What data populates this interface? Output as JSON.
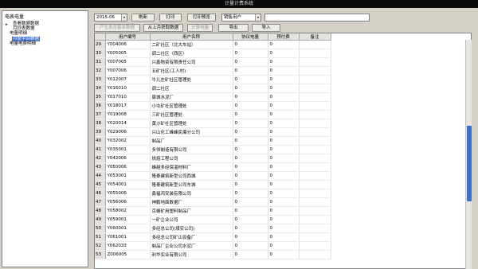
{
  "window": {
    "title": "计量计费系统"
  },
  "tree": {
    "root": "电表电量",
    "items": [
      {
        "label": "查看数据数据",
        "selected": false
      },
      {
        "label": "月抄表数据",
        "selected": false
      },
      {
        "label": "电量明细",
        "selected": false
      },
      {
        "label": "月度中间数据",
        "selected": true
      },
      {
        "label": "电量电费明细",
        "selected": false
      }
    ]
  },
  "toolbar": {
    "month_value": "2015-06",
    "refresh_label": "刷新",
    "print_label": "打印",
    "print_preview_label": "打印预览",
    "user_type_value": "销售用户",
    "search_value": "",
    "generate_label": "产生本月基本数据",
    "fetch_last_label": "从上月获取数据",
    "calc_power_label": "计算电量",
    "export_label": "导出",
    "import_label": "导入"
  },
  "table": {
    "columns": [
      "",
      "用户编号",
      "用户名称",
      "协议电量",
      "预付费",
      "备注"
    ],
    "rows": [
      {
        "n": "29",
        "id": "Y004006",
        "name": "二矿社区（北大车站）",
        "qty": "0",
        "prepay": "0",
        "note": ""
      },
      {
        "n": "30",
        "id": "Y005005",
        "name": "调二社区（西区）",
        "qty": "0",
        "prepay": "0",
        "note": ""
      },
      {
        "n": "31",
        "id": "Y007005",
        "name": "兴鑫物资有限责任公司",
        "qty": "0",
        "prepay": "0",
        "note": ""
      },
      {
        "n": "32",
        "id": "Y007006",
        "name": "五矿社区(工人村)",
        "qty": "0",
        "prepay": "0",
        "note": ""
      },
      {
        "n": "33",
        "id": "Y012007",
        "name": "牛儿庄矿社区管理处",
        "qty": "0",
        "prepay": "0",
        "note": ""
      },
      {
        "n": "34",
        "id": "Y016010",
        "name": "调二社区",
        "qty": "0",
        "prepay": "0",
        "note": ""
      },
      {
        "n": "35",
        "id": "Y017010",
        "name": "康城水泥厂",
        "qty": "0",
        "prepay": "0",
        "note": ""
      },
      {
        "n": "36",
        "id": "Y018017",
        "name": "小屯矿社区管理处",
        "qty": "0",
        "prepay": "0",
        "note": ""
      },
      {
        "n": "37",
        "id": "Y019008",
        "name": "三矿社区管理处",
        "qty": "0",
        "prepay": "0",
        "note": ""
      },
      {
        "n": "38",
        "id": "Y020014",
        "name": "黄沙矿社区管理处",
        "qty": "0",
        "prepay": "0",
        "note": ""
      },
      {
        "n": "39",
        "id": "Y029006",
        "name": "兴山化工峰峰民爆分公司",
        "qty": "0",
        "prepay": "0",
        "note": ""
      },
      {
        "n": "40",
        "id": "Y032002",
        "name": "制品厂",
        "qty": "0",
        "prepay": "0",
        "note": ""
      },
      {
        "n": "41",
        "id": "Y035001",
        "name": "多领制造有限公司",
        "qty": "0",
        "prepay": "0",
        "note": ""
      },
      {
        "n": "42",
        "id": "Y042006",
        "name": "烘焙工程公司",
        "qty": "0",
        "prepay": "0",
        "note": ""
      },
      {
        "n": "43",
        "id": "Y050006",
        "name": "峰越多经保温材料厂",
        "qty": "0",
        "prepay": "0",
        "note": ""
      },
      {
        "n": "44",
        "id": "Y053001",
        "name": "隆泰建筑新型公司西城",
        "qty": "0",
        "prepay": "0",
        "note": ""
      },
      {
        "n": "45",
        "id": "Y054001",
        "name": "隆泰建筑新型公司东城",
        "qty": "0",
        "prepay": "0",
        "note": ""
      },
      {
        "n": "46",
        "id": "Y055006",
        "name": "鑫福鸿安装有限公司",
        "qty": "0",
        "prepay": "0",
        "note": ""
      },
      {
        "n": "47",
        "id": "Y056006",
        "name": "神鹏地面数据厂",
        "qty": "0",
        "prepay": "0",
        "note": ""
      },
      {
        "n": "48",
        "id": "Y058002",
        "name": "京峰矿用塑料制品厂",
        "qty": "0",
        "prepay": "0",
        "note": ""
      },
      {
        "n": "49",
        "id": "Y059001",
        "name": "一矿企业公司",
        "qty": "0",
        "prepay": "0",
        "note": ""
      },
      {
        "n": "50",
        "id": "Y060001",
        "name": "多经总公司(煤安公司)",
        "qty": "0",
        "prepay": "0",
        "note": ""
      },
      {
        "n": "51",
        "id": "Y061001",
        "name": "多经总公司矿山设备厂",
        "qty": "0",
        "prepay": "0",
        "note": ""
      },
      {
        "n": "52",
        "id": "Y062033",
        "name": "制品厂企业公司水泥厂",
        "qty": "0",
        "prepay": "0",
        "note": ""
      },
      {
        "n": "53",
        "id": "Z006005",
        "name": "利华实业有限公司",
        "qty": "0",
        "prepay": "0",
        "note": ""
      }
    ]
  },
  "colors": {
    "selection": "#3d6ec6",
    "titlebar": "#0a0a0a",
    "window_bg": "#d4d0c8"
  }
}
